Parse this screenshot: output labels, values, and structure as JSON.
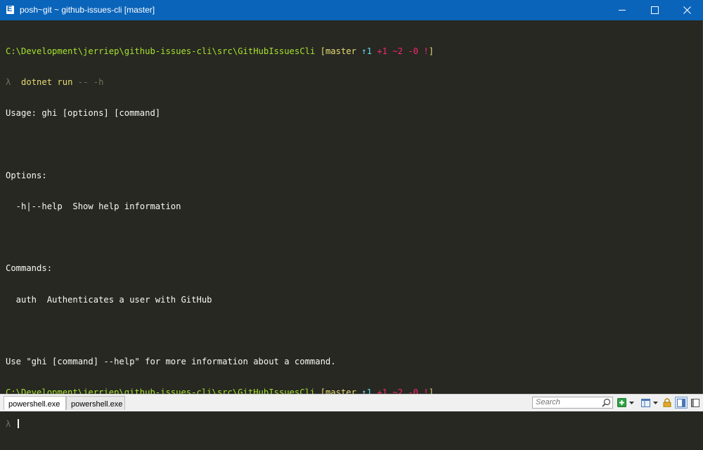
{
  "window": {
    "title": "posh~git ~ github-issues-cli [master]",
    "icon_letter": "E"
  },
  "console": {
    "prompt_path": "C:\\Development\\jerriep\\github-issues-cli\\src\\GitHubIssuesCli",
    "git_status": {
      "open": " [",
      "branch": "master",
      "ahead": " ↑1",
      "index": " +1 ~2 -0 !",
      "close": "]"
    },
    "lambda": "λ",
    "command_name": "dotnet run",
    "command_args": " -- -h",
    "output": [
      "Usage: ghi [options] [command]",
      "",
      "Options:",
      "  -h|--help  Show help information",
      "",
      "Commands:",
      "  auth  Authenticates a user with GitHub",
      "",
      "Use \"ghi [command] --help\" for more information about a command."
    ]
  },
  "bottom_bar": {
    "tabs": [
      "powershell.exe",
      "powershell.exe"
    ],
    "search_placeholder": "Search"
  },
  "colors": {
    "background": "#272822",
    "titlebar": "#0a64ba",
    "path": "#a6e22e",
    "branch": "#e6db74",
    "working": "#f92672"
  },
  "icons": [
    "app-icon",
    "minimize-icon",
    "maximize-icon",
    "close-icon",
    "search-icon",
    "add-tab-icon",
    "chevron-down-icon",
    "view-icon",
    "lock-icon",
    "pane-icon"
  ]
}
